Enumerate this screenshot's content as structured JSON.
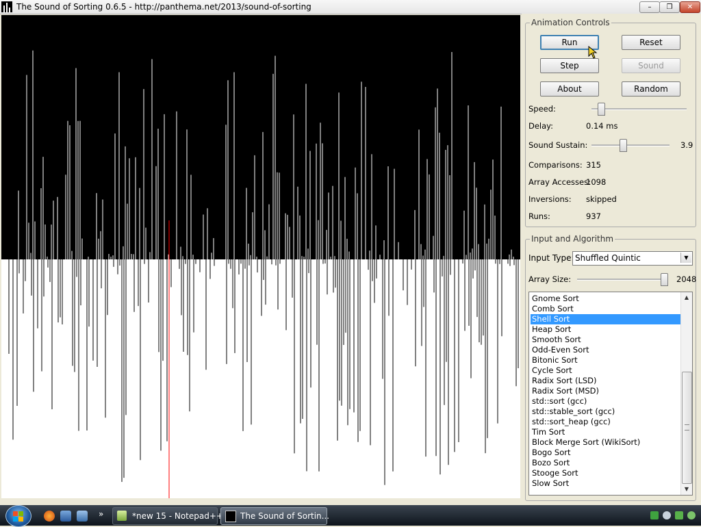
{
  "window": {
    "title": "The Sound of Sorting 0.6.5 - http://panthema.net/2013/sound-of-sorting",
    "min_glyph": "–",
    "max_glyph": "❐",
    "close_glyph": "✕"
  },
  "visualization": {
    "background": "#000000",
    "bar_color": "#ffffff",
    "highlight_color": "#ff0000"
  },
  "animation_controls": {
    "legend": "Animation Controls",
    "buttons": {
      "run": "Run",
      "reset": "Reset",
      "step": "Step",
      "sound": "Sound",
      "about": "About",
      "random": "Random"
    },
    "speed": {
      "label": "Speed:",
      "level": 0.07
    },
    "delay": {
      "label": "Delay:",
      "value": "0.14 ms"
    },
    "sound_sustain": {
      "label": "Sound Sustain:",
      "value": "3.9",
      "level": 0.39
    },
    "stats": {
      "comparisons_label": "Comparisons:",
      "comparisons": "315",
      "array_accesses_label": "Array Accesses:",
      "array_accesses": "1098",
      "inversions_label": "Inversions:",
      "inversions": "skipped",
      "runs_label": "Runs:",
      "runs": "937"
    }
  },
  "input_algorithm": {
    "legend": "Input and Algorithm",
    "input_type_label": "Input Type:",
    "input_type": "Shuffled Quintic",
    "array_size_label": "Array Size:",
    "array_size": "2048",
    "array_size_level": 0.98,
    "algorithms": [
      "Gnome Sort",
      "Comb Sort",
      "Shell Sort",
      "Heap Sort",
      "Smooth Sort",
      "Odd-Even Sort",
      "Bitonic Sort",
      "Cycle Sort",
      "Radix Sort (LSD)",
      "Radix Sort (MSD)",
      "std::sort (gcc)",
      "std::stable_sort (gcc)",
      "std::sort_heap (gcc)",
      "Tim Sort",
      "Block Merge Sort (WikiSort)",
      "Bogo Sort",
      "Bozo Sort",
      "Stooge Sort",
      "Slow Sort"
    ],
    "selected_index": 2
  },
  "taskbar": {
    "tasks": [
      {
        "label": "*new 15 - Notepad++",
        "active": false
      },
      {
        "label": "The Sound of Sortin...",
        "active": true
      }
    ],
    "chevron": "»"
  }
}
